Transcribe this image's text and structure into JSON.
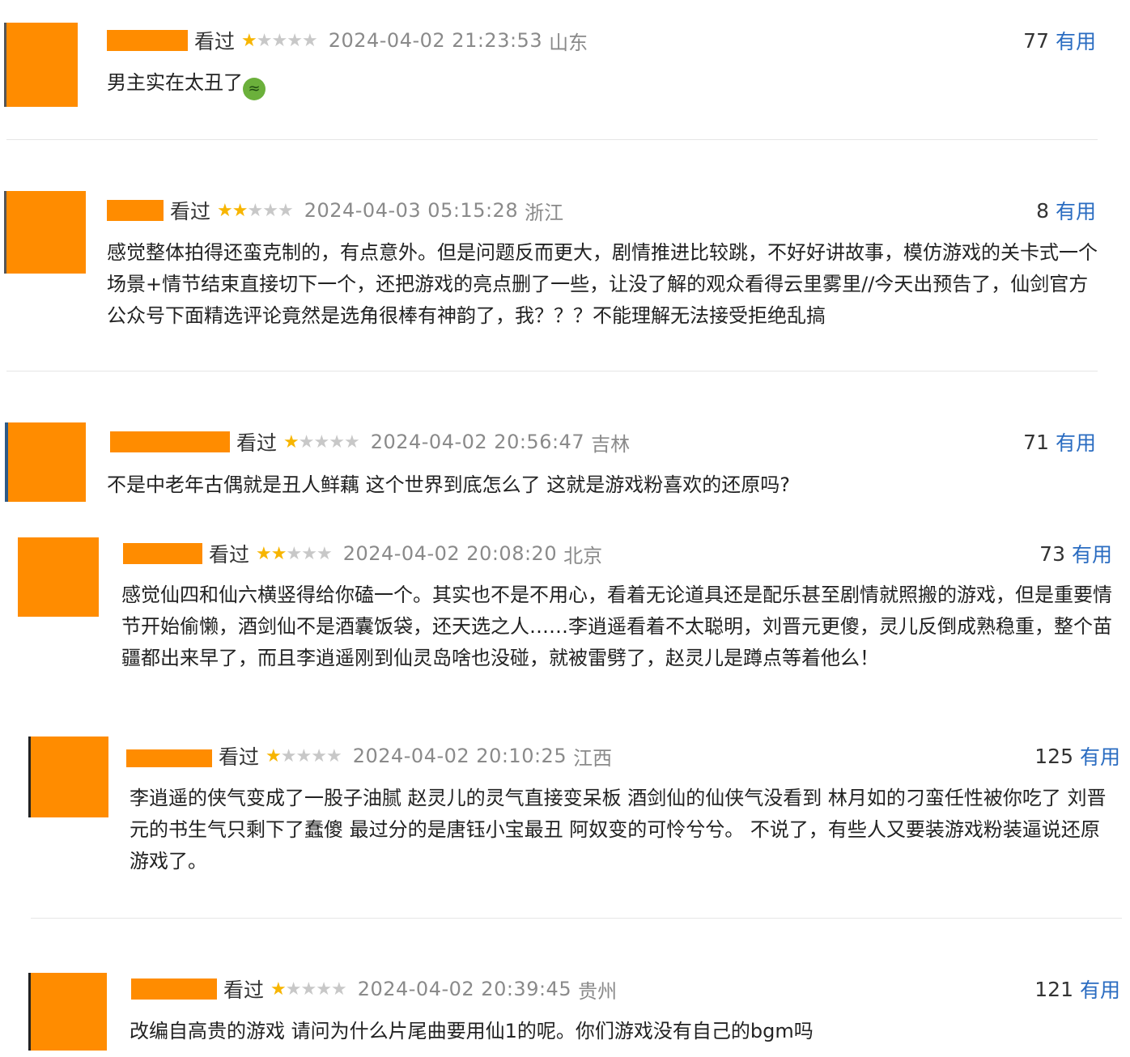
{
  "reviews": [
    {
      "watched": "看过",
      "rating": 1,
      "date": "2024-04-02 21:23:53",
      "region": "山东",
      "votes": "77",
      "useful": "有用",
      "comment": "男主实在太丑了",
      "emoji": "nauseated-face-icon"
    },
    {
      "watched": "看过",
      "rating": 2,
      "date": "2024-04-03 05:15:28",
      "region": "浙江",
      "votes": "8",
      "useful": "有用",
      "comment": "感觉整体拍得还蛮克制的，有点意外。但是问题反而更大，剧情推进比较跳，不好好讲故事，模仿游戏的关卡式一个场景+情节结束直接切下一个，还把游戏的亮点删了一些，让没了解的观众看得云里雾里//今天出预告了，仙剑官方公众号下面精选评论竟然是选角很棒有神韵了，我？？？不能理解无法接受拒绝乱搞"
    },
    {
      "watched": "看过",
      "rating": 1,
      "date": "2024-04-02 20:56:47",
      "region": "吉林",
      "votes": "71",
      "useful": "有用",
      "comment": "不是中老年古偶就是丑人鲜藕 这个世界到底怎么了 这就是游戏粉喜欢的还原吗?"
    },
    {
      "watched": "看过",
      "rating": 2,
      "date": "2024-04-02 20:08:20",
      "region": "北京",
      "votes": "73",
      "useful": "有用",
      "comment": "感觉仙四和仙六横竖得给你磕一个。其实也不是不用心，看着无论道具还是配乐甚至剧情就照搬的游戏，但是重要情节开始偷懒，酒剑仙不是酒囊饭袋，还天选之人……李逍遥看着不太聪明，刘晋元更傻，灵儿反倒成熟稳重，整个苗疆都出来早了，而且李逍遥刚到仙灵岛啥也没碰，就被雷劈了，赵灵儿是蹲点等着他么！"
    },
    {
      "watched": "看过",
      "rating": 1,
      "date": "2024-04-02 20:10:25",
      "region": "江西",
      "votes": "125",
      "useful": "有用",
      "comment": "李逍遥的侠气变成了一股子油腻 赵灵儿的灵气直接变呆板 酒剑仙的仙侠气没看到 林月如的刁蛮任性被你吃了 刘晋元的书生气只剩下了蠢傻 最过分的是唐钰小宝最丑 阿奴变的可怜兮兮。 不说了，有些人又要装游戏粉装逼说还原游戏了。"
    },
    {
      "watched": "看过",
      "rating": 1,
      "date": "2024-04-02 20:39:45",
      "region": "贵州",
      "votes": "121",
      "useful": "有用",
      "comment": "改编自高贵的游戏 请问为什么片尾曲要用仙1的呢。你们游戏没有自己的bgm吗"
    }
  ],
  "star_glyph": "★"
}
